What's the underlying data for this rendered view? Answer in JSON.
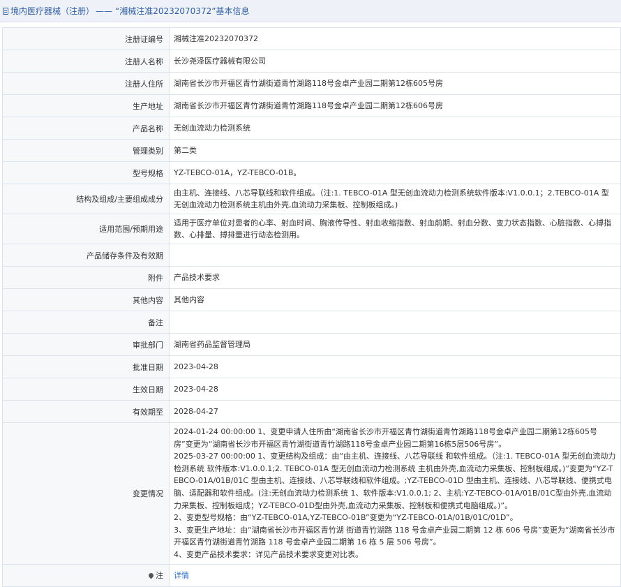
{
  "header": {
    "category": "境内医疗器械（注册）",
    "separator": "——",
    "title": "“湘械注准20232070372”基本信息"
  },
  "rows": [
    {
      "label": "注册证编号",
      "value": "湘械注准20232070372"
    },
    {
      "label": "注册人名称",
      "value": "长沙尧泽医疗器械有限公司"
    },
    {
      "label": "注册人住所",
      "value": "湖南省长沙市开福区青竹湖街道青竹湖路118号金卓产业园二期第12栋605号房"
    },
    {
      "label": "生产地址",
      "value": "湖南省长沙市开福区青竹湖街道青竹湖路118号金卓产业园二期第12栋606号房"
    },
    {
      "label": "产品名称",
      "value": "无创血流动力检测系统"
    },
    {
      "label": "管理类别",
      "value": "第二类"
    },
    {
      "label": "型号规格",
      "value": "YZ-TEBCO-01A，YZ-TEBCO-01B。"
    },
    {
      "label": "结构及组成/主要组成成分",
      "value": "由主机、连接线、八芯导联线和软件组成。（注:1. TEBCO-01A 型无创血流动力检测系统软件版本:V1.0.0.1；2.TEBCO-01A 型无创血流动力检测系统主机由外壳,血流动力采集板、控制板组成。)"
    },
    {
      "label": "适用范围/预期用途",
      "value": "适用于医疗单位对患者的心率、射血时间、胸液传导性、射血收缩指数、射血前期、射血分数、变力状态指数、心脏指数、心搏指数、心排量、搏排量进行动态检测用。"
    },
    {
      "label": "产品储存条件及有效期",
      "value": ""
    },
    {
      "label": "附件",
      "value": "产品技术要求"
    },
    {
      "label": "其他内容",
      "value": "其他内容"
    },
    {
      "label": "备注",
      "value": ""
    },
    {
      "label": "审批部门",
      "value": "湖南省药品监督管理局"
    },
    {
      "label": "批准日期",
      "value": "2023-04-28"
    },
    {
      "label": "生效日期",
      "value": "2023-04-28"
    },
    {
      "label": "有效期至",
      "value": "2028-04-27"
    }
  ],
  "changes": {
    "label": "变更情况",
    "lines": [
      "2024-01-24 00:00:00 1、变更申请人住所由“湖南省长沙市开福区青竹湖街道青竹湖路118号金卓产业园二期第12栋605号房”变更为“湖南省长沙市开福区青竹湖街道青竹湖路118号金卓产业园二期第16栋5层506号房”。",
      "2025-03-27 00:00:00 1、变更结构及组成：由“由主机、连接线、八芯导联线 和软件组成。（注:1. TEBCO-01A 型无创血流动力检测系统 软件版本:V1.0.0.1;2. TEBCO-01A 型无创血流动力检测系统 主机由外壳,血流动力采集板、控制板组成。)”变更为“YZ-TEBCO-01A/01B/01C 型由主机、连接线、八芯导联线和软件组成。;YZ-TEBCO-01D 型由主机、连接线、八芯导联线、便携式电脑、适配器和软件组成。(注:无创血流动力检测系统 1、软件版本:V1.0.0.1; 2、主机:YZ-TEBCO-01A/01B/01C型由外壳,血流动力采集板、控制板组成；YZ-TEBCO-01D型由外壳,血流动力采集板、控制板和便携式电脑组成。)”。",
      "2、变更型号规格：由“YZ-TEBCO-01A,YZ-TEBCO-01B”变更为“YZ-TEBCO-01A/01B/01C/01D”。",
      "3、变更生产地址：由“湖南省长沙市开福区青竹湖 街道青竹湖路 118 号金卓产业园二期第 12 栋 606 号房”变更为“湖南省长沙市开福区青竹湖街道青竹湖路 118 号金卓产业园二期第 16 栋 5 层 506 号房”。",
      "4、变更产品技术要求：详见产品技术要求变更对比表。"
    ]
  },
  "note": {
    "icon": "pin-icon",
    "label": "注",
    "link": "详情"
  }
}
